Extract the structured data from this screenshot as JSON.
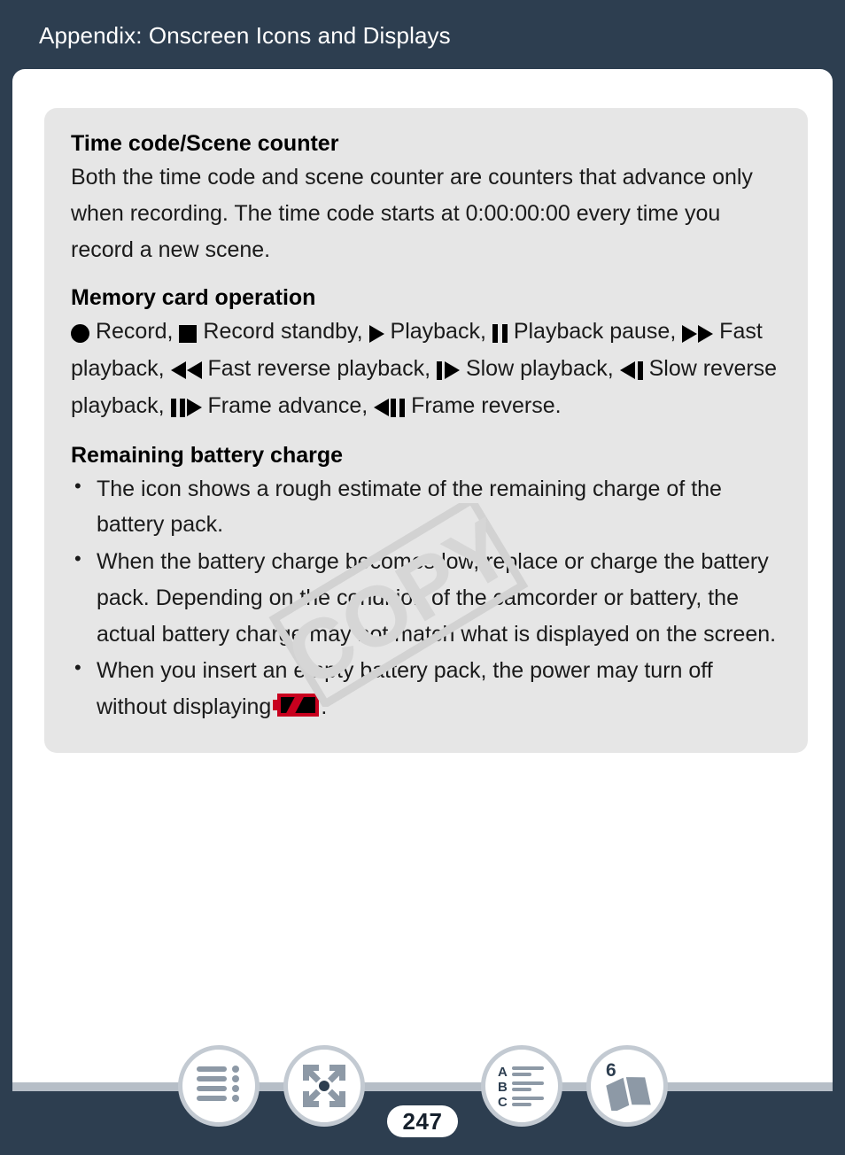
{
  "header": {
    "title": "Appendix: Onscreen Icons and Displays"
  },
  "watermark": {
    "text": "COPY"
  },
  "panel": {
    "sections": [
      {
        "id": "time-code",
        "title": "Time code/Scene counter",
        "body": "Both the time code and scene counter are counters that advance only when recording. The time code starts at 0:00:00:00 every time you record a new scene."
      },
      {
        "id": "memory-card-operation",
        "title": "Memory card operation",
        "items": [
          {
            "icon": "record-circle-icon",
            "label": "Record,"
          },
          {
            "icon": "record-standby-square-icon",
            "label": "Record standby,"
          },
          {
            "icon": "playback-triangle-icon",
            "label": "Playback,"
          },
          {
            "icon": "playback-pause-icon",
            "label": "Playback pause,"
          },
          {
            "icon": "fast-playback-icon",
            "label": "Fast playback,"
          },
          {
            "icon": "fast-reverse-playback-icon",
            "label": "Fast reverse playback,"
          },
          {
            "icon": "slow-playback-icon",
            "label": "Slow playback,"
          },
          {
            "icon": "slow-reverse-playback-icon",
            "label": "Slow reverse playback,"
          },
          {
            "icon": "frame-advance-icon",
            "label": "Frame advance,"
          },
          {
            "icon": "frame-reverse-icon",
            "label": "Frame reverse."
          }
        ]
      },
      {
        "id": "remaining-battery-charge",
        "title": "Remaining battery charge",
        "bullets": [
          "The icon shows a rough estimate of the remaining charge of the battery pack.",
          "When the battery charge becomes low, replace or charge the battery pack. Depending on the condition of the camcorder or battery, the actual battery charge may not match what is displayed on the screen.",
          "When you insert an empty battery pack, the power may turn off without displaying"
        ],
        "bullet3_suffix": ".",
        "bullet3_icon": "empty-battery-icon"
      }
    ]
  },
  "footer": {
    "page_number": "247",
    "buttons": [
      {
        "id": "table-of-contents",
        "icon": "table-of-contents-icon",
        "label": ""
      },
      {
        "id": "index-expand",
        "icon": "four-arrows-expand-icon",
        "label": ""
      },
      {
        "id": "alphabetical-index",
        "icon": "abc-index-icon",
        "label": ""
      },
      {
        "id": "chapter-book",
        "icon": "open-book-icon",
        "label": "6"
      }
    ]
  },
  "colors": {
    "background": "#2d3e50",
    "page": "#ffffff",
    "panel": "#e6e6e6",
    "text": "#1a1a1a",
    "battery_red": "#c8001e",
    "footer_ring": "#c3cad2",
    "footer_icon": "#8d99a6",
    "footer_bar": "#b6bec7"
  }
}
